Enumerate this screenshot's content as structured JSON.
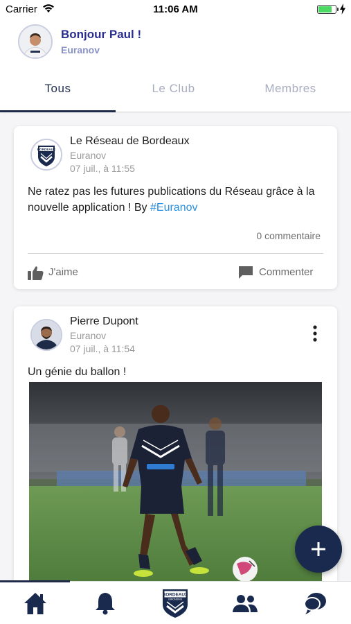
{
  "status_bar": {
    "carrier": "Carrier",
    "time": "11:06 AM",
    "battery_level": 0.8
  },
  "header": {
    "greeting": "Bonjour Paul !",
    "organization": "Euranov"
  },
  "tabs": [
    {
      "label": "Tous",
      "active": true
    },
    {
      "label": "Le Club",
      "active": false
    },
    {
      "label": "Membres",
      "active": false
    }
  ],
  "posts": [
    {
      "author": "Le Réseau de Bordeaux",
      "organization": "Euranov",
      "date": "07 juil., à 11:55",
      "text": "Ne ratez pas les futures publications du Réseau grâce à la nouvelle application ! By ",
      "hashtag": "#Euranov",
      "comments_count": "0 commentaire",
      "like_label": "J'aime",
      "comment_label": "Commenter"
    },
    {
      "author": "Pierre Dupont",
      "organization": "Euranov",
      "date": "07 juil., à 11:54",
      "text": "Un génie du ballon !"
    }
  ],
  "logo_text": {
    "line1": "BORDEAUX",
    "line2": "GIRONDINS"
  },
  "colors": {
    "navy": "#1a2a4e",
    "accent_blue": "#2a2f8f",
    "hashtag": "#2a8fe0",
    "inactive_tab": "#a9adc0"
  },
  "bottom_nav": [
    {
      "icon": "home-icon",
      "active": true
    },
    {
      "icon": "bell-icon",
      "active": false
    },
    {
      "icon": "club-logo-icon",
      "active": false
    },
    {
      "icon": "members-icon",
      "active": false
    },
    {
      "icon": "chat-icon",
      "active": false
    }
  ]
}
